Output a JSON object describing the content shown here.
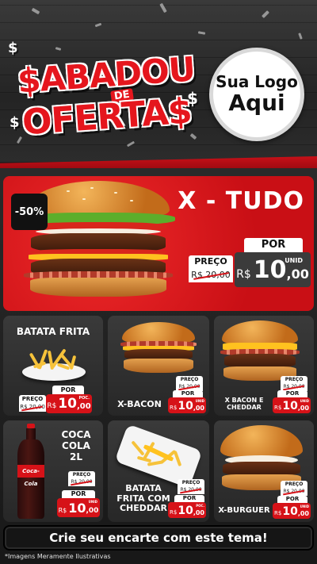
{
  "header": {
    "title_line1": "$ABADOU",
    "title_de": "DE",
    "title_line2": "OFERTA$",
    "dollar_sign": "$",
    "logo_top": "Sua Logo",
    "logo_bottom": "Aqui"
  },
  "hero": {
    "discount": "-50%",
    "name": "X - TUDO",
    "preco_label": "PREÇO",
    "old_price": "R$ 20,00",
    "por_label": "POR",
    "currency": "R$",
    "price_int": "10",
    "price_dec": ",00",
    "unit": "UNID"
  },
  "products": [
    {
      "name": "BATATA FRITA",
      "preco_label": "PREÇO",
      "old_price": "R$ 20,00",
      "por_label": "POR",
      "currency": "R$",
      "price_int": "10",
      "price_dec": ",00",
      "unit": "POC."
    },
    {
      "name": "X-BACON",
      "preco_label": "PREÇO",
      "old_price": "R$ 20,00",
      "por_label": "POR",
      "currency": "R$",
      "price_int": "10",
      "price_dec": ",00",
      "unit": "UNID"
    },
    {
      "name": "X BACON E CHEDDAR",
      "preco_label": "PREÇO",
      "old_price": "R$ 20,00",
      "por_label": "POR",
      "currency": "R$",
      "price_int": "10",
      "price_dec": ",00",
      "unit": "UNID"
    },
    {
      "name": "COCA COLA 2L",
      "preco_label": "PREÇO",
      "old_price": "R$ 20,00",
      "por_label": "POR",
      "currency": "R$",
      "price_int": "10",
      "price_dec": ",00",
      "unit": "UNID",
      "bottle_label": "Coca-Cola"
    },
    {
      "name": "BATATA FRITA COM CHEDDAR",
      "preco_label": "PREÇO",
      "old_price": "R$ 20,00",
      "por_label": "POR",
      "currency": "R$",
      "price_int": "10",
      "price_dec": ",00",
      "unit": "POC."
    },
    {
      "name": "X-BURGUER",
      "preco_label": "PREÇO",
      "old_price": "R$ 20,00",
      "por_label": "POR",
      "currency": "R$",
      "price_int": "10",
      "price_dec": ",00",
      "unit": "UNID"
    }
  ],
  "footer": {
    "cta": "Crie seu encarte com este tema!",
    "disclaimer": "*Imagens Meramente Ilustrativas"
  },
  "colors": {
    "accent_red": "#d61218",
    "background_dark": "#1b1b1b"
  }
}
